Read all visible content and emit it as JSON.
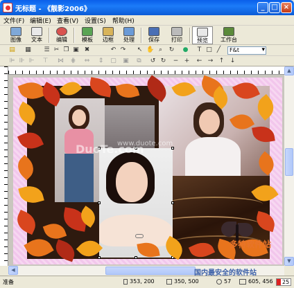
{
  "window": {
    "title": "无标题 - 《靓影2006》",
    "min_label": "_",
    "max_label": "□",
    "close_label": "×"
  },
  "menu": [
    "文件(F)",
    "编辑(E)",
    "查看(V)",
    "设置(S)",
    "帮助(H)"
  ],
  "toolbar": {
    "buttons": [
      "图像",
      "文本",
      "编辑",
      "模板",
      "边框",
      "处理",
      "保存",
      "打印",
      "预览",
      "工作台"
    ]
  },
  "font_combo": {
    "value": "F&t"
  },
  "watermarks": {
    "duote": "DuoTe.com",
    "site": "www.duote.com",
    "brand": "多特软件站",
    "brand_sub": "国内最安全的软件站"
  },
  "status": {
    "ready": "准备",
    "pos1": "353, 200",
    "pos2": "350, 500",
    "zoom": "57",
    "size": "605, 456",
    "badge": "25"
  },
  "colors": {
    "title_bar": "#0A5FEA",
    "page_bg": "#F2C6EC",
    "leaf_orange": "#E8741C",
    "leaf_red": "#C8321A"
  }
}
